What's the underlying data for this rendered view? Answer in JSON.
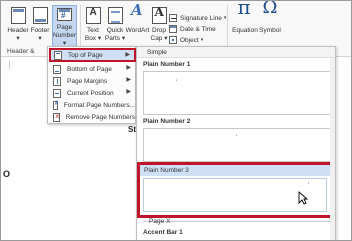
{
  "ribbon": {
    "buttons": [
      {
        "label": "Header",
        "sub": "▾"
      },
      {
        "label": "Footer",
        "sub": "▾"
      },
      {
        "label": "Page",
        "sub": "Number ▾"
      },
      {
        "label": "Text",
        "sub": "Box ▾"
      },
      {
        "label": "Quick",
        "sub": "Parts ▾"
      },
      {
        "label": "WordArt",
        "sub": ""
      },
      {
        "label": "Drop",
        "sub": "Cap ▾"
      },
      {
        "label": "Equation",
        "sub": ""
      },
      {
        "label": "Symbol",
        "sub": ""
      }
    ],
    "small_items": [
      {
        "label": "Signature Line"
      },
      {
        "label": "Date & Time"
      },
      {
        "label": "Object"
      }
    ],
    "group_label_header": "Header &"
  },
  "menu": {
    "items": [
      {
        "label": "Top of Page",
        "underline_char": "T",
        "has_submenu": true
      },
      {
        "label": "Bottom of Page",
        "underline_char": "B",
        "has_submenu": true
      },
      {
        "label": "Page Margins",
        "underline_char": "P",
        "has_submenu": true
      },
      {
        "label": "Current Position",
        "underline_char": "C",
        "has_submenu": true
      },
      {
        "label": "Format Page Numbers...",
        "underline_char": "F",
        "has_submenu": false
      },
      {
        "label": "Remove Page Numbers",
        "underline_char": "R",
        "has_submenu": false
      }
    ]
  },
  "gallery": {
    "header": "Simple",
    "items": [
      {
        "title": "Plain Number 1"
      },
      {
        "title": "Plain Number 2"
      },
      {
        "title": "Plain Number 3"
      },
      {
        "title": "Page X"
      },
      {
        "title": "Accent Bar 1"
      }
    ],
    "selected_index": 2
  },
  "document": {
    "visible_text": "Sta",
    "left_letter": "O"
  },
  "colors": {
    "highlight_border": "#c0142a",
    "hover_fill": "#cfe0f4",
    "accent": "#3b6fb6"
  }
}
